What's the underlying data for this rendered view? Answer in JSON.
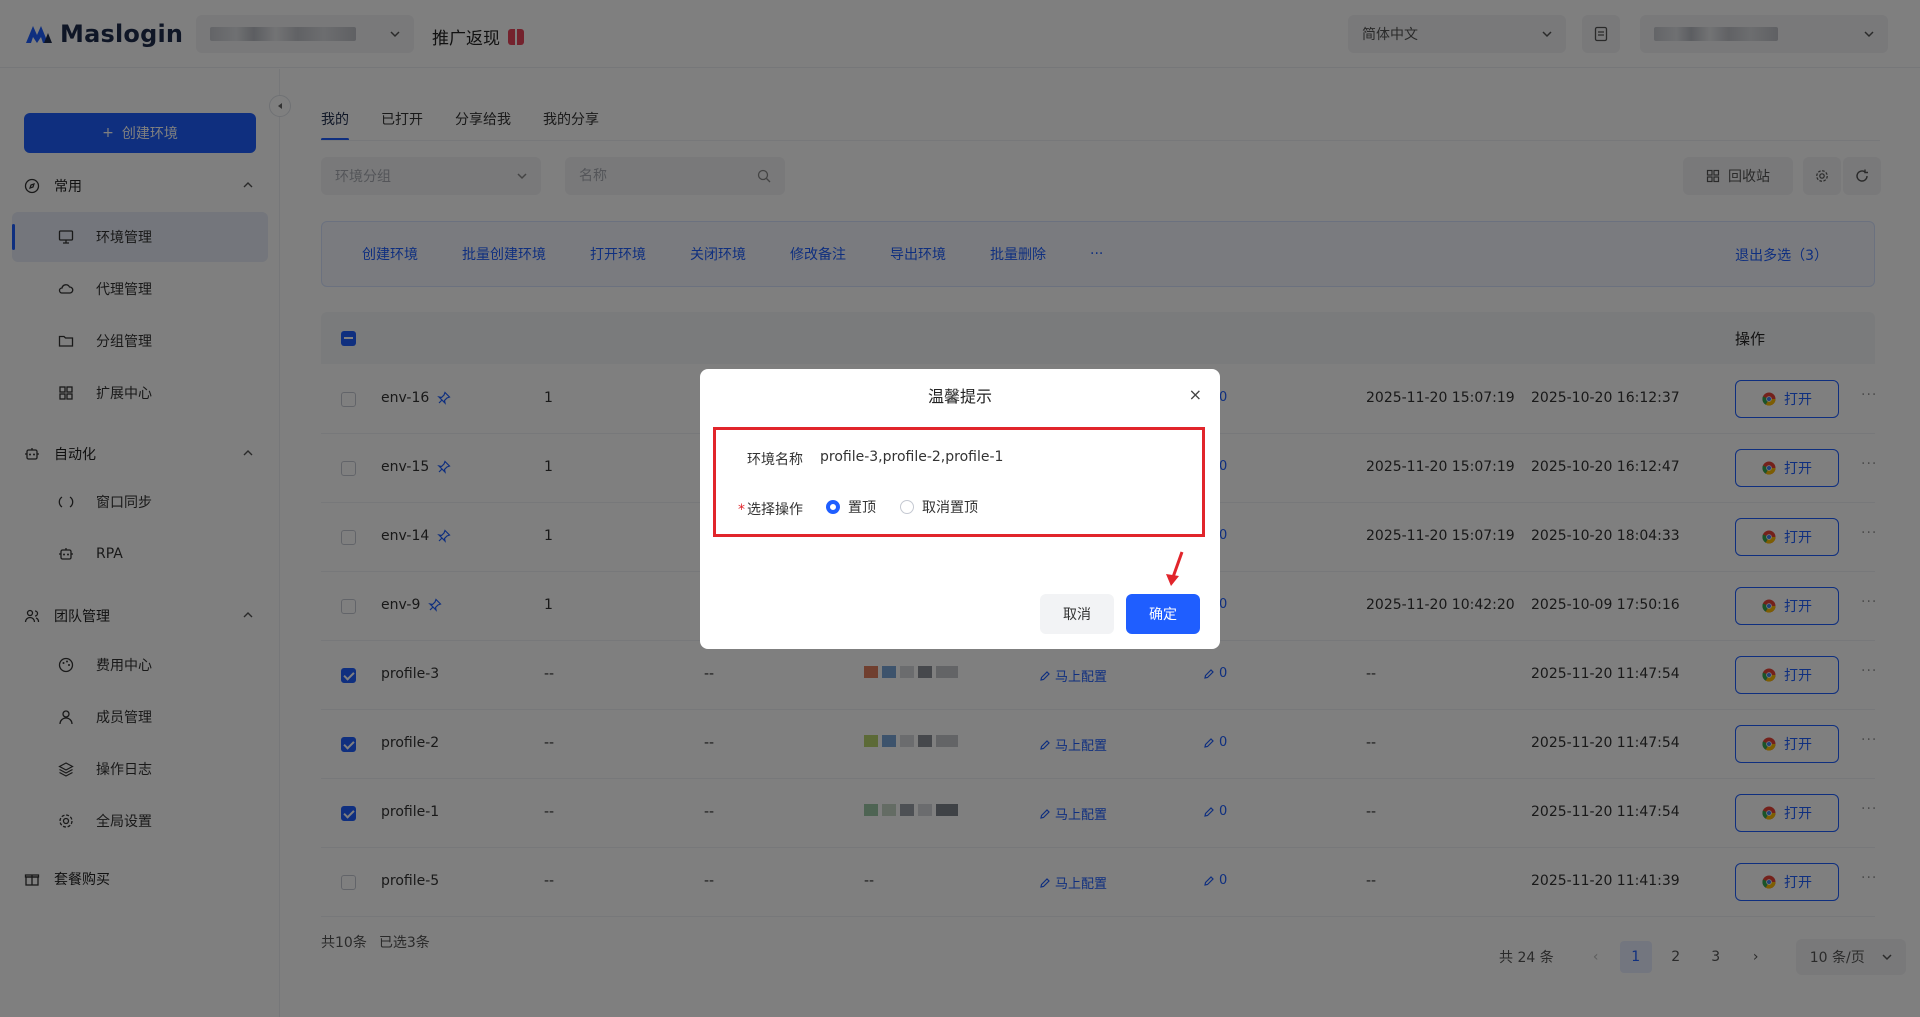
{
  "header": {
    "logo_text": "Maslogin",
    "promo_label": "推广返现",
    "language": "简体中文"
  },
  "sidebar": {
    "create_button": "创建环境",
    "sections": [
      {
        "label": "常用",
        "items": [
          "环境管理",
          "代理管理",
          "分组管理",
          "扩展中心"
        ]
      },
      {
        "label": "自动化",
        "items": [
          "窗口同步",
          "RPA"
        ]
      },
      {
        "label": "团队管理",
        "items": [
          "费用中心",
          "成员管理",
          "操作日志",
          "全局设置"
        ]
      }
    ],
    "bottom_item": "套餐购买",
    "active_item": "环境管理"
  },
  "tabs": [
    "我的",
    "已打开",
    "分享给我",
    "我的分享"
  ],
  "filters": {
    "group_placeholder": "环境分组",
    "name_placeholder": "名称",
    "recycle_label": "回收站"
  },
  "batch_actions": [
    "创建环境",
    "批量创建环境",
    "打开环境",
    "关闭环境",
    "修改备注",
    "导出环境",
    "批量删除",
    "···"
  ],
  "exit_multi": "退出多选（3）",
  "table": {
    "op_header": "操作",
    "open_label": "打开",
    "more_label": "···",
    "config_label": "马上配置",
    "rows": [
      {
        "name": "env-16",
        "pinned": true,
        "c2": "1",
        "c3": "",
        "proxy": false,
        "config": false,
        "remark": "0",
        "c7": "2025-11-20 15:07:19",
        "c8": "2025-10-20 16:12:37",
        "checked": false
      },
      {
        "name": "env-15",
        "pinned": true,
        "c2": "1",
        "c3": "",
        "proxy": false,
        "config": false,
        "remark": "0",
        "c7": "2025-11-20 15:07:19",
        "c8": "2025-10-20 16:12:47",
        "checked": false
      },
      {
        "name": "env-14",
        "pinned": true,
        "c2": "1",
        "c3": "",
        "proxy": false,
        "config": false,
        "remark": "0",
        "c7": "2025-11-20 15:07:19",
        "c8": "2025-10-20 18:04:33",
        "checked": false
      },
      {
        "name": "env-9",
        "pinned": true,
        "c2": "1",
        "c3": "",
        "proxy": false,
        "config": false,
        "remark": "0",
        "c7": "2025-11-20 10:42:20",
        "c8": "2025-10-09 17:50:16",
        "checked": false
      },
      {
        "name": "profile-3",
        "pinned": false,
        "c2": "--",
        "c3": "--",
        "proxy": true,
        "config": true,
        "remark": "0",
        "c7": "--",
        "c8": "2025-11-20 11:47:54",
        "checked": true
      },
      {
        "name": "profile-2",
        "pinned": false,
        "c2": "--",
        "c3": "--",
        "proxy": true,
        "config": true,
        "remark": "0",
        "c7": "--",
        "c8": "2025-11-20 11:47:54",
        "checked": true
      },
      {
        "name": "profile-1",
        "pinned": false,
        "c2": "--",
        "c3": "--",
        "proxy": true,
        "config": true,
        "remark": "0",
        "c7": "--",
        "c8": "2025-11-20 11:47:54",
        "checked": true
      },
      {
        "name": "profile-5",
        "pinned": false,
        "c2": "--",
        "c3": "--",
        "c4": "--",
        "proxy": false,
        "config": true,
        "remark": "0",
        "c7": "--",
        "c8": "2025-11-20 11:41:39",
        "checked": false
      }
    ]
  },
  "footer": {
    "count": "共10条",
    "selected": "已选3条",
    "total": "共 24 条",
    "pages": [
      "1",
      "2",
      "3"
    ],
    "current_page": "1",
    "prev": "‹",
    "next": "›",
    "per_page": "10 条/页"
  },
  "modal": {
    "title": "温馨提示",
    "close": "×",
    "name_label": "环境名称",
    "name_value": "profile-3,profile-2,profile-1",
    "op_required": "*",
    "op_label": "选择操作",
    "options": [
      "置顶",
      "取消置顶"
    ],
    "selected_option": "置顶",
    "cancel": "取消",
    "ok": "确定"
  },
  "colors": {
    "primary": "#1f5eff",
    "highlight_border": "#e1252b",
    "overlay": "rgba(0,0,0,0.5)"
  }
}
